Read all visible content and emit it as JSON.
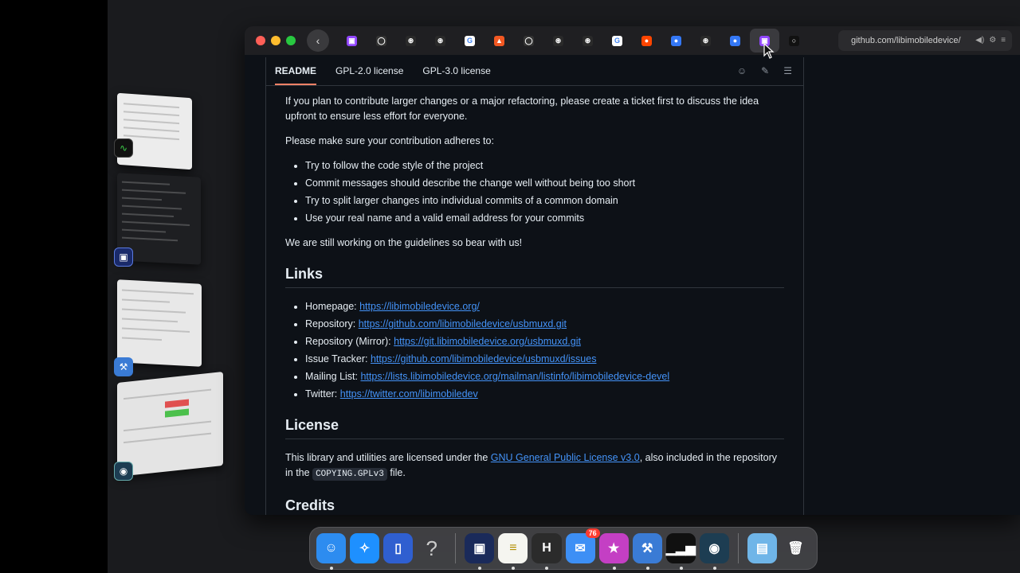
{
  "browser": {
    "address_text": "github.com/libimobiledevice/",
    "tabs": [
      {
        "icon": "twitch-icon",
        "color": "#9146ff",
        "glyph": "▣"
      },
      {
        "icon": "github-icon",
        "color": "#333333",
        "glyph": "◯"
      },
      {
        "icon": "openai-icon",
        "color": "#2a2a2a",
        "glyph": "⊛"
      },
      {
        "icon": "openai-icon",
        "color": "#2a2a2a",
        "glyph": "⊛"
      },
      {
        "icon": "google-icon",
        "color": "#ffffff",
        "glyph": "G"
      },
      {
        "icon": "brave-icon",
        "color": "#f25822",
        "glyph": "▲"
      },
      {
        "icon": "github-icon",
        "color": "#333333",
        "glyph": "◯"
      },
      {
        "icon": "openai-icon",
        "color": "#2a2a2a",
        "glyph": "⊛"
      },
      {
        "icon": "openai-icon",
        "color": "#2a2a2a",
        "glyph": "⊛"
      },
      {
        "icon": "google-icon",
        "color": "#ffffff",
        "glyph": "G"
      },
      {
        "icon": "reddit-icon",
        "color": "#ff4500",
        "glyph": "●"
      },
      {
        "icon": "browser-icon",
        "color": "#3478f6",
        "glyph": "●"
      },
      {
        "icon": "openai-icon",
        "color": "#2a2a2a",
        "glyph": "⊛"
      },
      {
        "icon": "browser-icon",
        "color": "#3478f6",
        "glyph": "●"
      },
      {
        "icon": "twitch-icon",
        "color": "#9146ff",
        "glyph": "▣"
      },
      {
        "icon": "circle-icon",
        "color": "#111111",
        "glyph": "○"
      }
    ]
  },
  "readme": {
    "tabs": [
      "README",
      "GPL-2.0 license",
      "GPL-3.0 license"
    ],
    "intro_paragraph": "If you plan to contribute larger changes or a major refactoring, please create a ticket first to discuss the idea upfront to ensure less effort for everyone.",
    "adheres_paragraph": "Please make sure your contribution adheres to:",
    "guidelines": [
      "Try to follow the code style of the project",
      "Commit messages should describe the change well without being too short",
      "Try to split larger changes into individual commits of a common domain",
      "Use your real name and a valid email address for your commits"
    ],
    "still_working": "We are still working on the guidelines so bear with us!",
    "links_heading": "Links",
    "links": [
      {
        "label": "Homepage: ",
        "url": "https://libimobiledevice.org/"
      },
      {
        "label": "Repository: ",
        "url": "https://github.com/libimobiledevice/usbmuxd.git"
      },
      {
        "label": "Repository (Mirror): ",
        "url": "https://git.libimobiledevice.org/usbmuxd.git"
      },
      {
        "label": "Issue Tracker: ",
        "url": "https://github.com/libimobiledevice/usbmuxd/issues"
      },
      {
        "label": "Mailing List: ",
        "url": "https://lists.libimobiledevice.org/mailman/listinfo/libimobiledevice-devel"
      },
      {
        "label": "Twitter: ",
        "url": "https://twitter.com/libimobiledev"
      }
    ],
    "license_heading": "License",
    "license_text_1": "This library and utilities are licensed under the ",
    "license_link": "GNU General Public License v3.0",
    "license_text_2": ", also included in the repository in the ",
    "license_file": "COPYING.GPLv3",
    "license_text_3": " file.",
    "credits_heading": "Credits"
  },
  "dock": {
    "items": [
      {
        "name": "finder",
        "glyph": "☺",
        "color": "#2d8cf0",
        "running": true
      },
      {
        "name": "safari",
        "glyph": "✧",
        "color": "#1e90ff",
        "running": false
      },
      {
        "name": "app-blue",
        "glyph": "▯",
        "color": "#2f5fd0",
        "running": false
      },
      {
        "name": "help",
        "glyph": "?",
        "color": "transparent",
        "running": false
      },
      {
        "name": "sep"
      },
      {
        "name": "terminal-app",
        "glyph": "▣",
        "color": "#1a2a5a",
        "running": true
      },
      {
        "name": "notes",
        "glyph": "≡",
        "color": "#f5f5f0",
        "running": true
      },
      {
        "name": "hammerspoon",
        "glyph": "H",
        "color": "#2b2b2b",
        "running": true
      },
      {
        "name": "mail",
        "glyph": "✉",
        "color": "#3d8ff5",
        "running": false,
        "badge": "76"
      },
      {
        "name": "app-store-beta",
        "glyph": "★",
        "color": "#c43fc4",
        "running": true
      },
      {
        "name": "xcode-beta",
        "glyph": "⚒",
        "color": "#3a7bd5",
        "running": true
      },
      {
        "name": "activity-monitor",
        "glyph": "▁▂▅",
        "color": "#101010",
        "running": true
      },
      {
        "name": "instruments-beta",
        "glyph": "◉",
        "color": "#1d3d52",
        "running": true
      },
      {
        "name": "sep"
      },
      {
        "name": "downloads-folder",
        "glyph": "▤",
        "color": "#6fb5e8",
        "running": false
      },
      {
        "name": "trash",
        "glyph": "🗑",
        "color": "transparent",
        "running": false
      }
    ]
  }
}
